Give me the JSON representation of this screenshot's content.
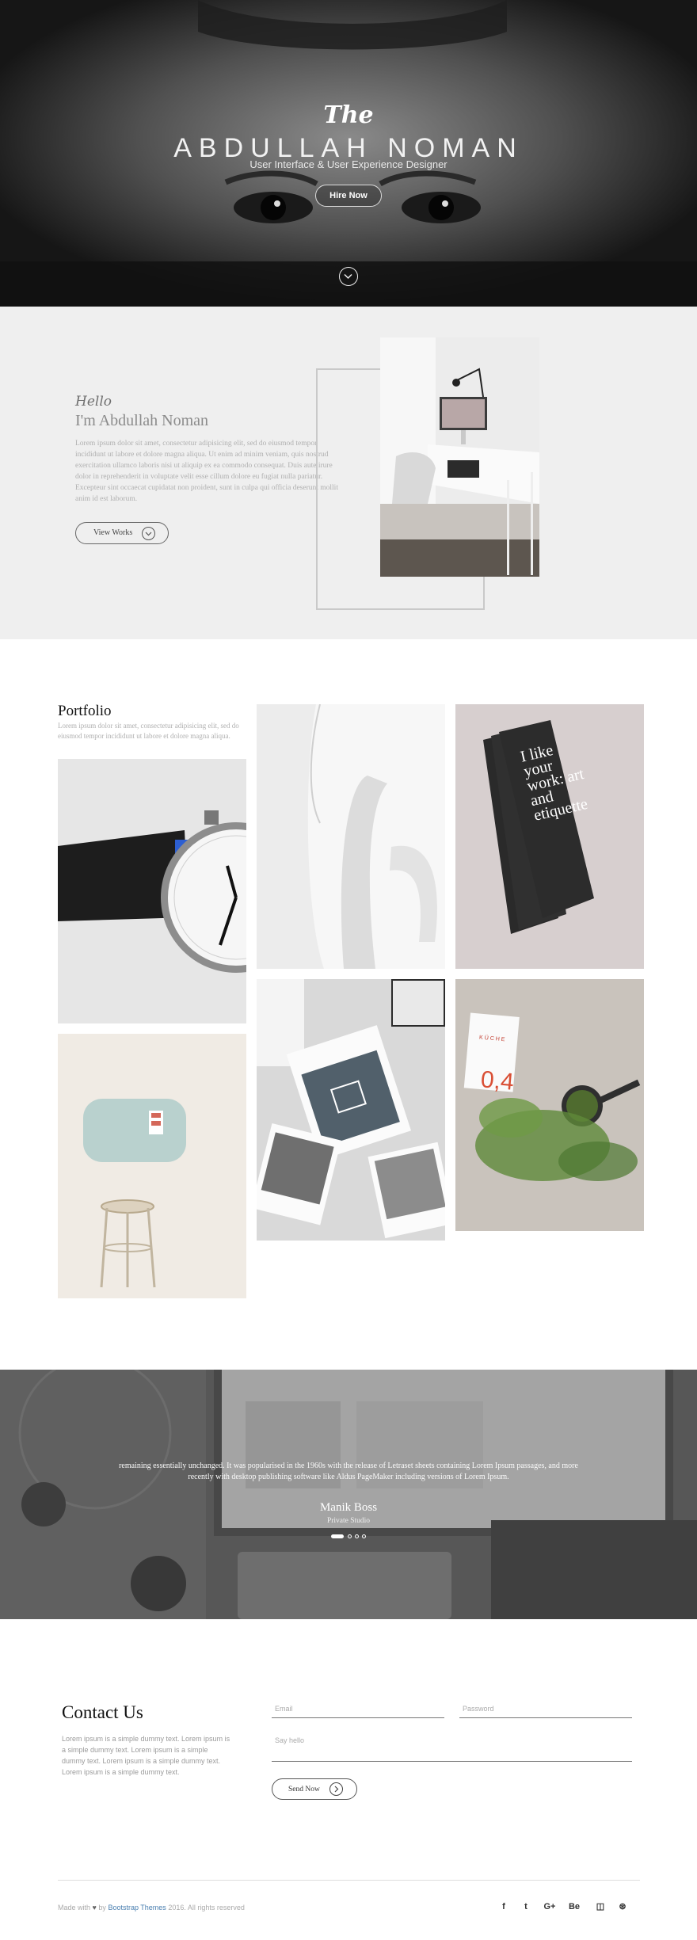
{
  "hero": {
    "script_title": "The",
    "name": "ABDULLAH NOMAN",
    "subtitle": "User Interface & User Experience Designer",
    "hire_label": "Hire Now",
    "scroll_icon": "chevron-down-icon"
  },
  "about": {
    "hello": "Hello",
    "title": "I'm Abdullah Noman",
    "text": "Lorem ipsum dolor sit amet, consectetur adipisicing elit, sed do eiusmod tempor incididunt ut labore et dolore magna aliqua. Ut enim ad minim veniam, quis nostrud exercitation ullamco laboris nisi ut aliquip ex ea commodo consequat. Duis aute irure dolor in reprehenderit in voluptate velit esse cillum dolore eu fugiat nulla pariatur. Excepteur sint occaecat cupidatat non proident, sunt in culpa qui officia deserunt mollit anim id est laborum.",
    "works_label": "View Works",
    "works_icon": "chevron-down-icon"
  },
  "portfolio": {
    "title": "Portfolio",
    "text": "Lorem ipsum dolor sit amet, consectetur adipisicing elit, sed do eiusmod tempor incididunt ut labore et dolore magna aliqua.",
    "card_text": "I like your work: art and etiquette",
    "menu_word": "KÜCHE",
    "menu_number": "0,4"
  },
  "testimonial": {
    "quote": "remaining essentially unchanged. It was popularised in the 1960s with the release of Letraset sheets containing Lorem Ipsum passages, and more recently with desktop publishing software like Aldus PageMaker including versions of Lorem Ipsum.",
    "name": "Manik Boss",
    "role": "Private Studio",
    "slides": 4,
    "active_slide": 1
  },
  "contact": {
    "title": "Contact Us",
    "text": "Lorem ipsum is a simple dummy text. Lorem ipsum is a simple dummy text. Lorem ipsum is a simple dummy text. Lorem ipsum is a simple dummy text. Lorem ipsum is a simple dummy text.",
    "email_placeholder": "Email",
    "password_placeholder": "Password",
    "message_placeholder": "Say hello",
    "send_label": "Send Now",
    "send_icon": "chevron-right-icon"
  },
  "footer": {
    "made_with": "Made with",
    "by": "by",
    "brand": "Bootstrap Themes",
    "rights": "2016. All rights reserved",
    "social": [
      {
        "icon": "facebook-icon",
        "glyph": "f"
      },
      {
        "icon": "twitter-icon",
        "glyph": "t"
      },
      {
        "icon": "google-plus-icon",
        "glyph": "G+"
      },
      {
        "icon": "behance-icon",
        "glyph": "Be"
      },
      {
        "icon": "instagram-icon",
        "glyph": "◫"
      },
      {
        "icon": "dribbble-icon",
        "glyph": "⊛"
      }
    ]
  },
  "colors": {
    "about_bg": "#efefef",
    "link": "#4a7fb0",
    "text_muted": "#b0b0b0"
  }
}
